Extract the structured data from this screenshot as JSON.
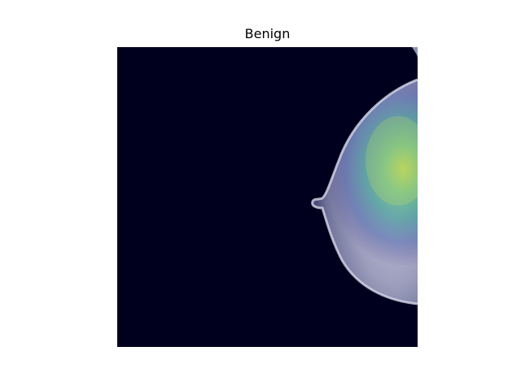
{
  "figure": {
    "title": "Benign"
  },
  "image": {
    "subject": "mammogram-with-heatmap-overlay",
    "background_color": "#00001e",
    "heatmap_colormap": "viridis"
  }
}
